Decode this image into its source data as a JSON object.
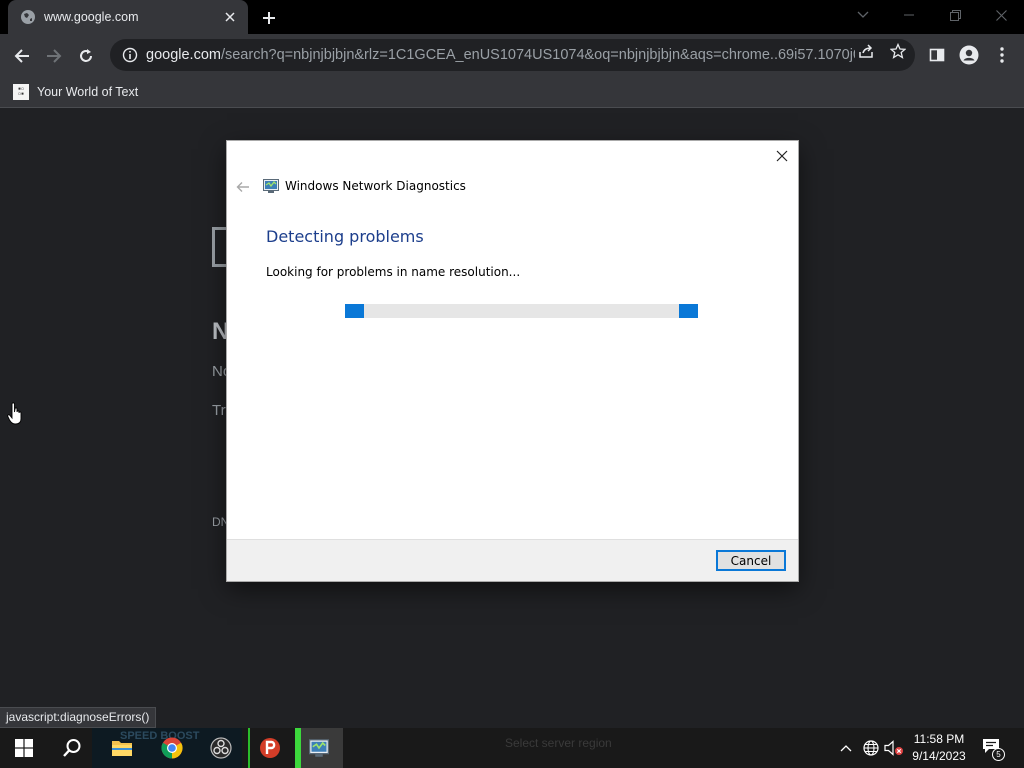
{
  "browser": {
    "tab": {
      "title": "www.google.com"
    },
    "omnibox": {
      "host": "google.com",
      "path": "/search?q=nbjnjbjbjn&rlz=1C1GCEA_enUS1074US1074&oq=nbjnjbjbjn&aqs=chrome..69i57.1070j0j..."
    },
    "bookmarks": [
      {
        "label": "Your World of Text"
      }
    ],
    "status_text": "javascript:diagnoseErrors()"
  },
  "page": {
    "heading_partial": "N",
    "line1_partial": "No",
    "line2_partial": "Try",
    "code_partial": "DN"
  },
  "dialog": {
    "title": "Windows Network Diagnostics",
    "heading": "Detecting problems",
    "status": "Looking for problems in name resolution...",
    "cancel_label": "Cancel",
    "accent_color": "#0a78d7"
  },
  "taskbar": {
    "ghost_text_1": "SPEED BOOST",
    "ghost_text_2": "Select server region",
    "clock_time": "11:58 PM",
    "clock_date": "9/14/2023",
    "notification_count": "5"
  }
}
